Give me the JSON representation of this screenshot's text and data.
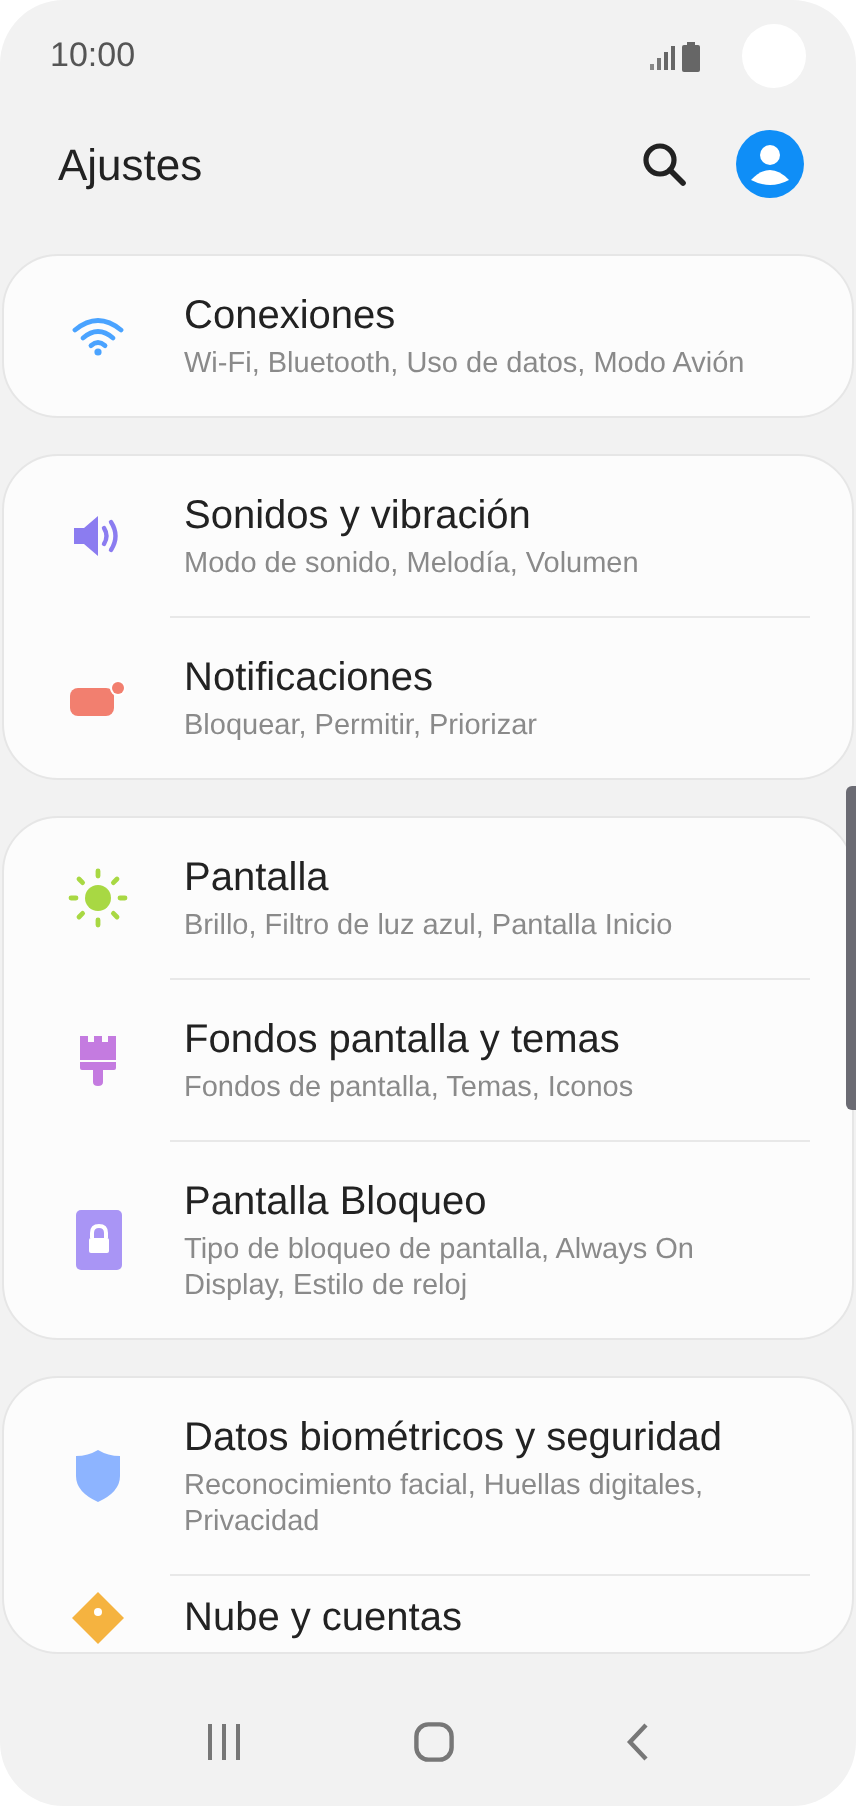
{
  "status_bar": {
    "time": "10:00"
  },
  "header": {
    "title": "Ajustes"
  },
  "groups": [
    {
      "items": [
        {
          "kind": "wifi",
          "title": "Conexiones",
          "subtitle": "Wi-Fi, Bluetooth, Uso de datos, Modo Avión"
        }
      ]
    },
    {
      "items": [
        {
          "kind": "sound",
          "title": "Sonidos y vibración",
          "subtitle": "Modo de sonido, Melodía, Volumen"
        },
        {
          "kind": "notifications",
          "title": "Notificaciones",
          "subtitle": "Bloquear, Permitir, Priorizar"
        }
      ]
    },
    {
      "items": [
        {
          "kind": "display",
          "title": "Pantalla",
          "subtitle": "Brillo, Filtro de luz azul, Pantalla Inicio"
        },
        {
          "kind": "wallpaper",
          "title": "Fondos pantalla y temas",
          "subtitle": "Fondos de pantalla, Temas, Iconos"
        },
        {
          "kind": "lock",
          "title": "Pantalla Bloqueo",
          "subtitle": "Tipo de bloqueo de pantalla, Always On Display, Estilo de reloj"
        }
      ]
    },
    {
      "items": [
        {
          "kind": "security",
          "title": "Datos biométricos y seguridad",
          "subtitle": "Reconocimiento facial, Huellas digitales, Privacidad"
        },
        {
          "kind": "cloud",
          "title": "Nube y cuentas"
        }
      ]
    }
  ]
}
